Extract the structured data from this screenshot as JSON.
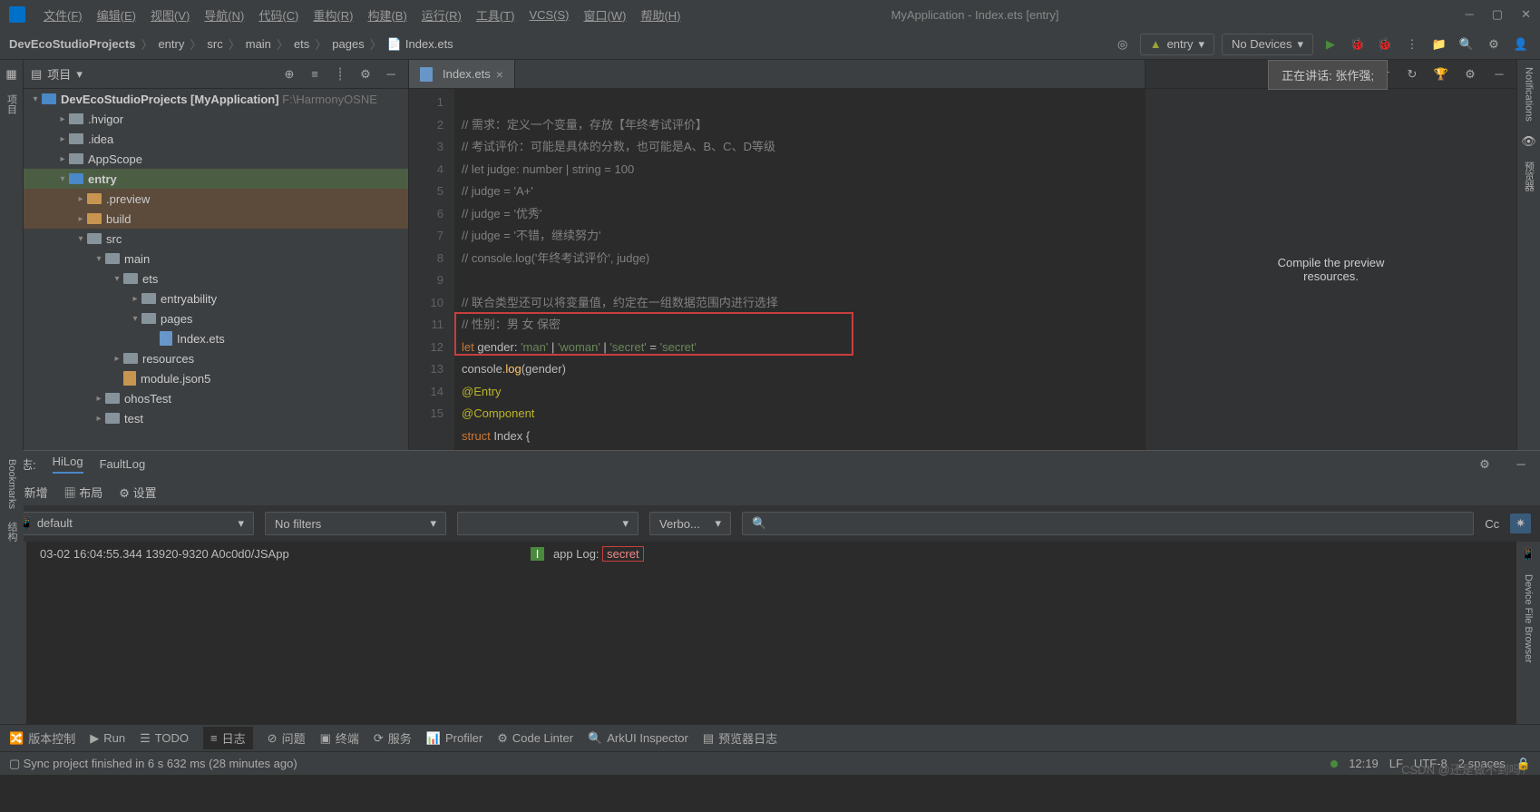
{
  "menu": {
    "file": "文件(F)",
    "edit": "编辑(E)",
    "view": "视图(V)",
    "nav": "导航(N)",
    "code": "代码(C)",
    "refactor": "重构(R)",
    "build": "构建(B)",
    "run": "运行(R)",
    "tools": "工具(T)",
    "vcs": "VCS(S)",
    "window": "窗口(W)",
    "help": "帮助(H)"
  },
  "app_title": "MyApplication - Index.ets [entry]",
  "breadcrumb": {
    "p1": "DevEcoStudioProjects",
    "p2": "entry",
    "p3": "src",
    "p4": "main",
    "p5": "ets",
    "p6": "pages",
    "p7": "Index.ets"
  },
  "toolbar": {
    "module": "entry",
    "device": "No Devices"
  },
  "panel": {
    "title": "项目"
  },
  "tree": {
    "root": "DevEcoStudioProjects [MyApplication]",
    "root_path": "F:\\HarmonyOSNE",
    "hvigor": ".hvigor",
    "idea": ".idea",
    "appscope": "AppScope",
    "entry": "entry",
    "preview": ".preview",
    "build": "build",
    "src": "src",
    "main": "main",
    "ets": "ets",
    "entryability": "entryability",
    "pages": "pages",
    "indexets": "Index.ets",
    "resources": "resources",
    "module": "module.json5",
    "ohostest": "ohosTest",
    "test": "test"
  },
  "tab": {
    "name": "Index.ets"
  },
  "code": {
    "l1": "// 需求：定义一个变量，存放【年终考试评价】",
    "l2": "// 考试评价：可能是具体的分数，也可能是A、B、C、D等级",
    "l3": "// let judge: number | string = 100",
    "l4": "// judge = 'A+'",
    "l5": "// judge = '优秀'",
    "l6": "// judge = '不错，继续努力'",
    "l7": "// console.log('年终考试评价', judge)",
    "l9": "// 联合类型还可以将变量值，约定在一组数据范围内进行选择",
    "l10": "// 性别：男 女 保密",
    "l11_kw": "let",
    "l11_var": " gender: ",
    "l11_s1": "'man'",
    "l11_p1": " | ",
    "l11_s2": "'woman'",
    "l11_p2": " | ",
    "l11_s3": "'secret'",
    "l11_eq": " = ",
    "l11_s4": "'secret'",
    "l12_a": "console.",
    "l12_fn": "log",
    "l12_b": "(gender)",
    "l13": "@Entry",
    "l14": "@Component",
    "l15_kw": "struct",
    "l15_b": " Index {"
  },
  "tooltip": "正在讲话:   张作强;",
  "preview": {
    "text": "Compile the preview\nresources."
  },
  "log": {
    "title": "日志:",
    "tab1": "HiLog",
    "tab2": "FaultLog",
    "add": "新增",
    "layout": "布局",
    "settings": "设置",
    "device": "default",
    "filter": "No filters",
    "level": "Verbo...",
    "search": "",
    "line": "03-02 16:04:55.344   13920-9320    A0c0d0/JSApp",
    "app_log": "app Log:",
    "secret": "secret",
    "cc": "Cc"
  },
  "bottom": {
    "vcs": "版本控制",
    "run": "Run",
    "todo": "TODO",
    "log": "日志",
    "problems": "问题",
    "terminal": "终端",
    "services": "服务",
    "profiler": "Profiler",
    "linter": "Code Linter",
    "inspector": "ArkUI Inspector",
    "previewlog": "预览器日志"
  },
  "status": {
    "msg": "Sync project finished in 6 s 632 ms (28 minutes ago)",
    "pos": "12:19",
    "lf": "LF",
    "enc": "UTF-8",
    "indent": "2 spaces"
  },
  "watermark": "CSDN @还是做不到吗?",
  "sidebar": {
    "project": "项目",
    "structure": "结构",
    "bookmarks": "Bookmarks",
    "notifications": "Notifications",
    "previewer": "预览器",
    "devicefile": "Device File Browser"
  }
}
